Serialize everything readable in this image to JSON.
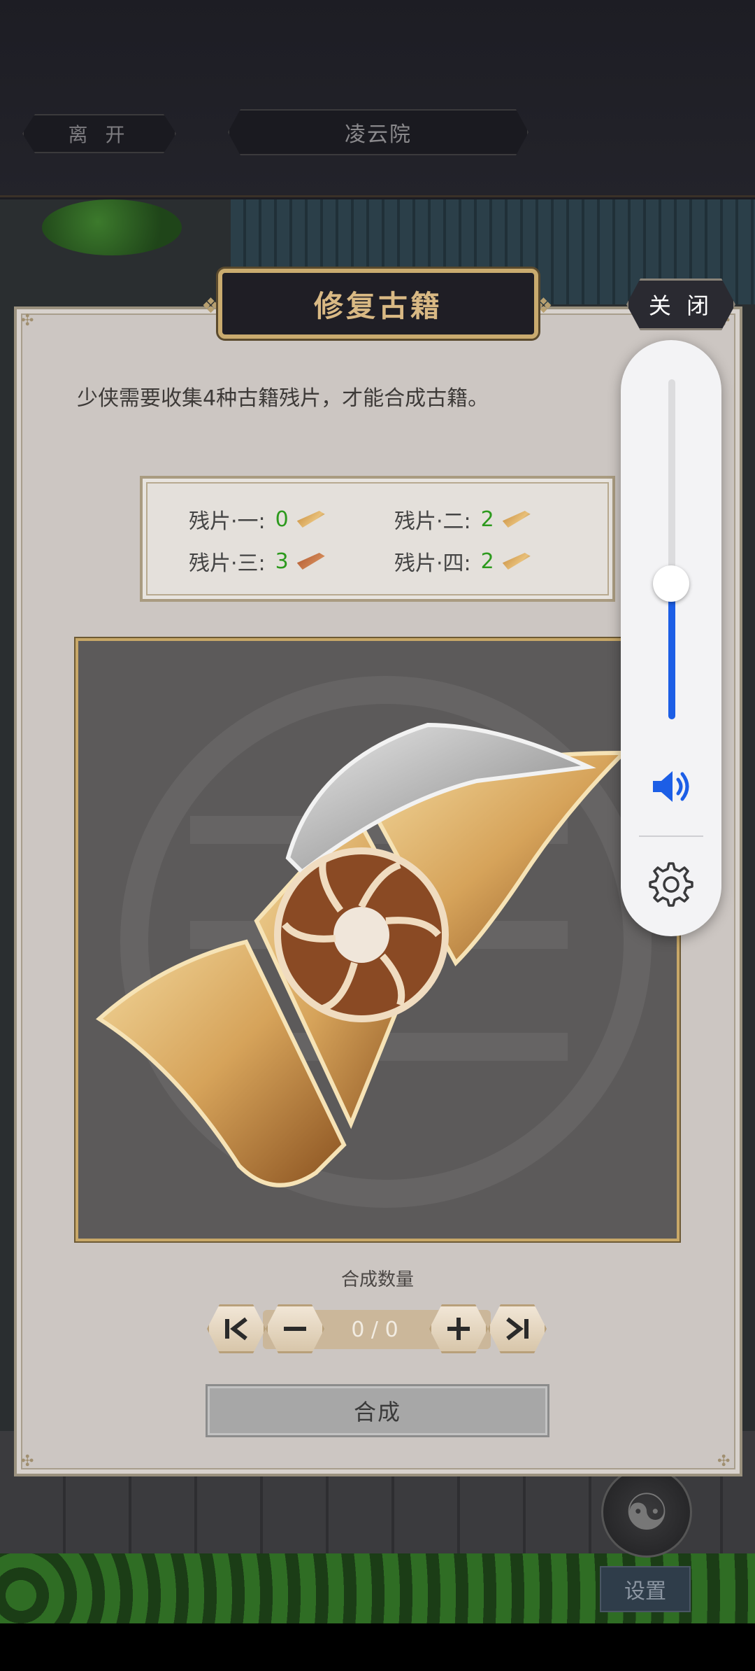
{
  "header": {
    "leave_label": "离 开",
    "location": "凌云院"
  },
  "dialog": {
    "title": "修复古籍",
    "close_label": "关 闭",
    "description": "少侠需要收集4种古籍残片，才能合成古籍。",
    "fragments": [
      {
        "label": "残片·一:",
        "count": "0"
      },
      {
        "label": "残片·二:",
        "count": "2"
      },
      {
        "label": "残片·三:",
        "count": "3"
      },
      {
        "label": "残片·四:",
        "count": "2"
      }
    ],
    "quantity_label": "合成数量",
    "quantity_value": "0 / 0",
    "craft_label": "合成"
  },
  "hud": {
    "settings_label": "设置"
  },
  "volume": {
    "level_fraction": 0.4
  },
  "colors": {
    "count_green": "#2d9a1e",
    "volume_blue": "#1c5ee6",
    "title_gold": "#d9b984"
  }
}
